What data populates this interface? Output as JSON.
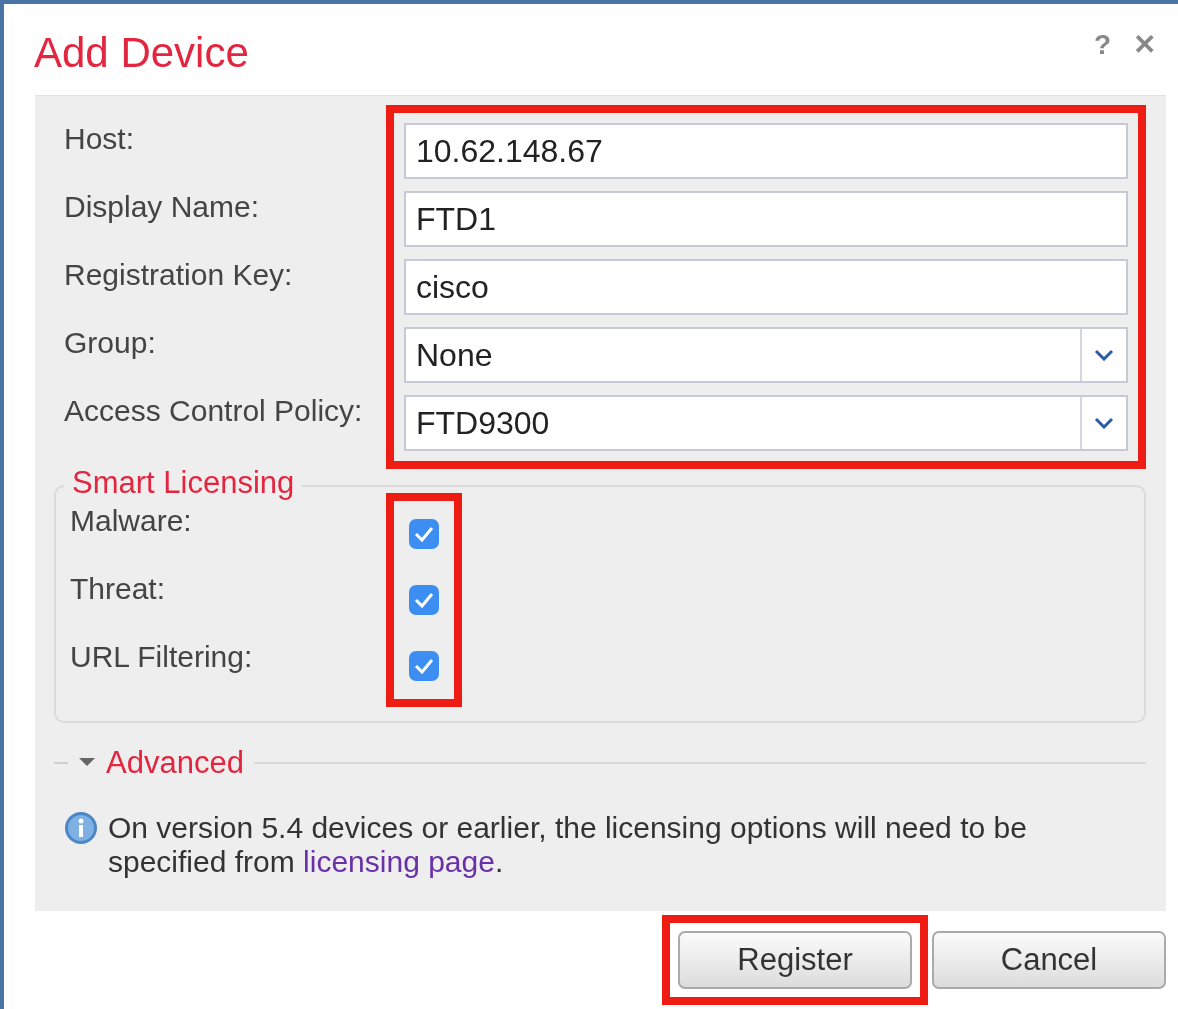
{
  "dialog": {
    "title": "Add Device",
    "help": "?",
    "close": "✕"
  },
  "form": {
    "highlighted": true,
    "fields": [
      {
        "label": "Host:",
        "kind": "text",
        "value": "10.62.148.67"
      },
      {
        "label": "Display Name:",
        "kind": "text",
        "value": "FTD1"
      },
      {
        "label": "Registration Key:",
        "kind": "text",
        "value": "cisco"
      },
      {
        "label": "Group:",
        "kind": "select",
        "value": "None"
      },
      {
        "label": "Access Control Policy:",
        "kind": "select",
        "value": "FTD9300"
      }
    ]
  },
  "smart_licensing": {
    "title": "Smart Licensing",
    "highlighted": true,
    "options": [
      {
        "label": "Malware:",
        "checked": true
      },
      {
        "label": "Threat:",
        "checked": true
      },
      {
        "label": "URL Filtering:",
        "checked": true
      }
    ]
  },
  "advanced": {
    "label": "Advanced",
    "expanded": true
  },
  "info": {
    "text": "On version 5.4 devices or earlier, the licensing options will need to be specified from ",
    "link": "licensing page",
    "after": "."
  },
  "buttons": [
    {
      "label": "Register",
      "highlighted": true
    },
    {
      "label": "Cancel",
      "highlighted": false
    }
  ]
}
